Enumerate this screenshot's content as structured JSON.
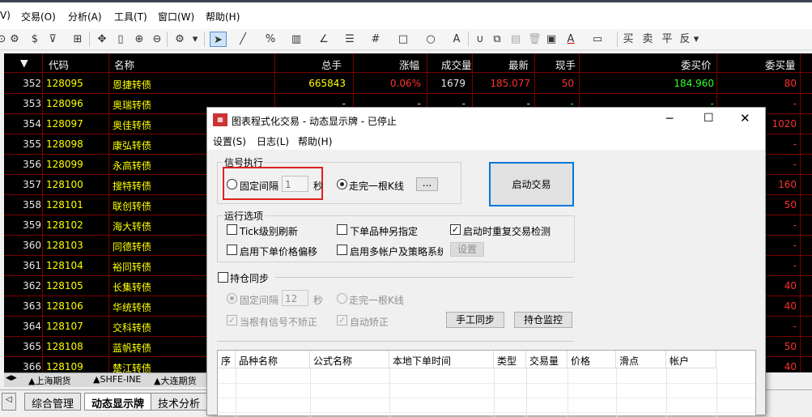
{
  "menubar": {
    "items": [
      "V)",
      "交易(O)",
      "分析(A)",
      "工具(T)",
      "窗口(W)",
      "帮助(H)"
    ]
  },
  "toolbar": {
    "trade_buttons": [
      "买",
      "卖",
      "平",
      "反"
    ]
  },
  "grid": {
    "headers": [
      "▼",
      "代码",
      "名称",
      "总手",
      "涨幅",
      "成交量",
      "最新",
      "现手",
      "委买价",
      "委买量"
    ],
    "rows": [
      {
        "idx": "352",
        "code": "128095",
        "name": "恩捷转债",
        "total": "665843",
        "change": "0.06%",
        "volume": "1679",
        "last": "185.077",
        "cur": "50",
        "bid": "184.960",
        "bidvol": "80"
      },
      {
        "idx": "353",
        "code": "128096",
        "name": "奥瑞转债",
        "total": "-",
        "change": "-",
        "volume": "-",
        "last": "-",
        "cur": "-",
        "bid": "-",
        "bidvol": "-"
      },
      {
        "idx": "354",
        "code": "128097",
        "name": "奥佳转债",
        "total": "",
        "change": "",
        "volume": "",
        "last": "",
        "cur": "",
        "bid": "",
        "bidvol": "1020"
      },
      {
        "idx": "355",
        "code": "128098",
        "name": "康弘转债",
        "total": "",
        "change": "",
        "volume": "",
        "last": "",
        "cur": "",
        "bid": "",
        "bidvol": "-"
      },
      {
        "idx": "356",
        "code": "128099",
        "name": "永高转债",
        "total": "",
        "change": "",
        "volume": "",
        "last": "",
        "cur": "",
        "bid": "",
        "bidvol": "-"
      },
      {
        "idx": "357",
        "code": "128100",
        "name": "搜特转债",
        "total": "",
        "change": "",
        "volume": "",
        "last": "",
        "cur": "",
        "bid": "",
        "bidvol": "160"
      },
      {
        "idx": "358",
        "code": "128101",
        "name": "联创转债",
        "total": "",
        "change": "",
        "volume": "",
        "last": "",
        "cur": "",
        "bid": "",
        "bidvol": "50"
      },
      {
        "idx": "359",
        "code": "128102",
        "name": "海大转债",
        "total": "",
        "change": "",
        "volume": "",
        "last": "",
        "cur": "",
        "bid": "",
        "bidvol": "-"
      },
      {
        "idx": "360",
        "code": "128103",
        "name": "同德转债",
        "total": "",
        "change": "",
        "volume": "",
        "last": "",
        "cur": "",
        "bid": "",
        "bidvol": "-"
      },
      {
        "idx": "361",
        "code": "128104",
        "name": "裕同转债",
        "total": "",
        "change": "",
        "volume": "",
        "last": "",
        "cur": "",
        "bid": "",
        "bidvol": "-"
      },
      {
        "idx": "362",
        "code": "128105",
        "name": "长集转债",
        "total": "",
        "change": "",
        "volume": "",
        "last": "",
        "cur": "",
        "bid": "",
        "bidvol": "40"
      },
      {
        "idx": "363",
        "code": "128106",
        "name": "华统转债",
        "total": "",
        "change": "",
        "volume": "",
        "last": "",
        "cur": "",
        "bid": "",
        "bidvol": "40"
      },
      {
        "idx": "364",
        "code": "128107",
        "name": "交科转债",
        "total": "",
        "change": "",
        "volume": "",
        "last": "",
        "cur": "",
        "bid": "",
        "bidvol": "-"
      },
      {
        "idx": "365",
        "code": "128108",
        "name": "蓝帆转债",
        "total": "",
        "change": "",
        "volume": "",
        "last": "",
        "cur": "",
        "bid": "",
        "bidvol": "50"
      },
      {
        "idx": "366",
        "code": "128109",
        "name": "楚江转债",
        "total": "",
        "change": "",
        "volume": "",
        "last": "",
        "cur": "",
        "bid": "",
        "bidvol": "40"
      }
    ]
  },
  "exchange_tabs": [
    "▲上海期货",
    "▲SHFE-INE",
    "▲大连期货"
  ],
  "page_tabs": [
    "综合管理",
    "动态显示牌",
    "技术分析"
  ],
  "dialog": {
    "title": "图表程式化交易 - 动态显示牌 - 已停止",
    "menu": [
      "设置(S)",
      "日志(L)",
      "帮助(H)"
    ],
    "signal_group": "信号执行",
    "fixed_interval": "固定间隔",
    "interval_value": "1",
    "seconds": "秒",
    "per_kline": "走完一根K线",
    "more_button": "...",
    "start_button": "启动交易",
    "run_group": "运行选项",
    "opt_tick": "Tick级别刷新",
    "opt_order_variety": "下单品种另指定",
    "opt_repeat_check": "启动时重复交易检测",
    "opt_price_offset": "启用下单价格偏移",
    "opt_multi_account": "启用多帐户及策略系统",
    "settings_button": "设置",
    "position_sync": "持仓同步",
    "sync_fixed_interval": "固定间隔",
    "sync_interval_value": "12",
    "sync_seconds": "秒",
    "sync_per_kline": "走完一根K线",
    "sync_no_correct": "当根有信号不矫正",
    "sync_auto_correct": "自动矫正",
    "manual_sync_button": "手工同步",
    "position_monitor_button": "持仓监控",
    "table_headers": [
      "序",
      "品种名称",
      "公式名称",
      "本地下单时间",
      "类型",
      "交易量",
      "价格",
      "滑点",
      "帐户"
    ]
  },
  "colors": {
    "grid_bg": "#000000",
    "code_text": "#ffff00",
    "up_red": "#ff3030",
    "bid_green": "#30ff30",
    "grid_line": "#7a0000",
    "highlight_box": "#e02020"
  }
}
